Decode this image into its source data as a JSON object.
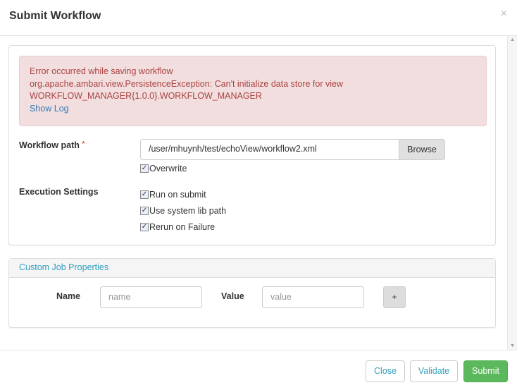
{
  "dialog": {
    "title": "Submit Workflow",
    "close_glyph": "×"
  },
  "alert": {
    "line1": "Error occurred while saving workflow",
    "line2": "org.apache.ambari.view.PersistenceException: Can't initialize data store for view",
    "line3": "WORKFLOW_MANAGER{1.0.0}.WORKFLOW_MANAGER",
    "show_log": "Show Log"
  },
  "form": {
    "workflow_path_label": "Workflow path",
    "required_mark": "*",
    "workflow_path_value": "/user/mhuynh/test/echoView/workflow2.xml",
    "browse": "Browse",
    "overwrite": "Overwrite",
    "execution_label": "Execution Settings",
    "run_on_submit": "Run on submit",
    "use_system_lib": "Use system lib path",
    "rerun_on_failure": "Rerun on Failure",
    "check": "✓"
  },
  "custom": {
    "title": "Custom Job Properties",
    "name_label": "Name",
    "name_placeholder": "name",
    "value_label": "Value",
    "value_placeholder": "value",
    "add": "+"
  },
  "footer": {
    "close": "Close",
    "validate": "Validate",
    "submit": "Submit"
  }
}
